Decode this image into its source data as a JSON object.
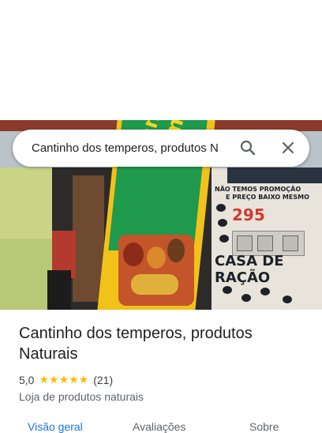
{
  "search": {
    "query": "Cantinho dos temperos, produtos N"
  },
  "place": {
    "name": "Cantinho dos temperos, produtos Naturais",
    "rating": "5,0",
    "stars": "★★★★★",
    "review_count": "(21)",
    "category": "Loja de produtos naturais"
  },
  "tabs": [
    {
      "label": "Visão geral"
    },
    {
      "label": "Avaliações"
    },
    {
      "label": "Sobre"
    }
  ],
  "photo_sign": {
    "banner": "Cantinho Temperos",
    "line1": "NÃO TEMOS PROMOÇÃO",
    "line2": "E PREÇO BAIXO MESMO",
    "number": "295",
    "store": "CASA DE RAÇÃO"
  },
  "colors": {
    "accent": "#1a73e8",
    "star": "#fbbc04",
    "text": "#202124"
  },
  "icons": {
    "search": "search-icon",
    "close": "close-icon"
  }
}
